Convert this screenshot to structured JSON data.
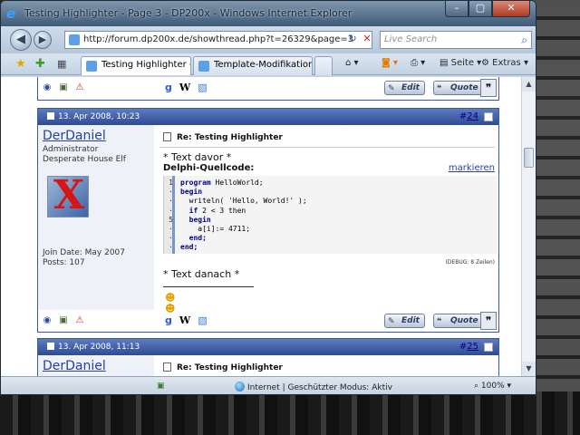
{
  "window": {
    "title": "Testing Highlighter - Page 3 - DP200x - Windows Internet Explorer",
    "buttons": {
      "minimize": "–",
      "maximize": "▢",
      "close": "✕"
    }
  },
  "navbar": {
    "url": "http://forum.dp200x.de/showthread.php?t=26329&page=3",
    "search_placeholder": "Live Search"
  },
  "tabs": [
    {
      "label": "Testing Highlighter - P...",
      "active": true
    },
    {
      "label": "Template-Modifikationen ...",
      "active": false
    }
  ],
  "toolbar": {
    "seite": "Seite",
    "extras": "Extras"
  },
  "posts": [
    {
      "footer": {
        "edit": "Edit",
        "quote": "Quote"
      }
    },
    {
      "date": "13. Apr 2008, 10:23",
      "num_prefix": "#",
      "num": "24",
      "username": "DerDaniel",
      "user_titles": [
        "Administrator",
        "Desperate House Elf"
      ],
      "join_date": "Join Date: May 2007",
      "posts": "Posts: 107",
      "title": "Re: Testing Highlighter",
      "text_before": "* Text davor *",
      "code_title": "Delphi-Quellcode:",
      "markieren": "markieren",
      "code_lines": [
        {
          "n": "1",
          "kw1": "program",
          "rest": " HelloWorld;"
        },
        {
          "n": "·",
          "kw1": "begin",
          "rest": ""
        },
        {
          "n": "·",
          "kw1": "",
          "rest": "  writeln( 'Hello, World!' );"
        },
        {
          "n": "·",
          "kw1": "  if",
          "rest": " 2 < 3 then"
        },
        {
          "n": "5",
          "kw1": "  begin",
          "rest": ""
        },
        {
          "n": "·",
          "kw1": "",
          "rest": "    a[i]:= 4711;"
        },
        {
          "n": "·",
          "kw1": "  end;",
          "rest": ""
        },
        {
          "n": "·",
          "kw1": "end;",
          "rest": ""
        }
      ],
      "debug": "(DEBUG: 8 Zeilen)",
      "text_after": "* Text danach *",
      "footer": {
        "edit": "Edit",
        "quote": "Quote"
      }
    },
    {
      "date": "13. Apr 2008, 11:13",
      "num_prefix": "#",
      "num": "25",
      "username": "DerDaniel",
      "title": "Re: Testing Highlighter"
    }
  ],
  "statusbar": {
    "zone": "Internet | Geschützter Modus: Aktiv",
    "zoom": "100%"
  },
  "colors": {
    "post_header": "#2d4b94",
    "link": "#2540a0"
  }
}
